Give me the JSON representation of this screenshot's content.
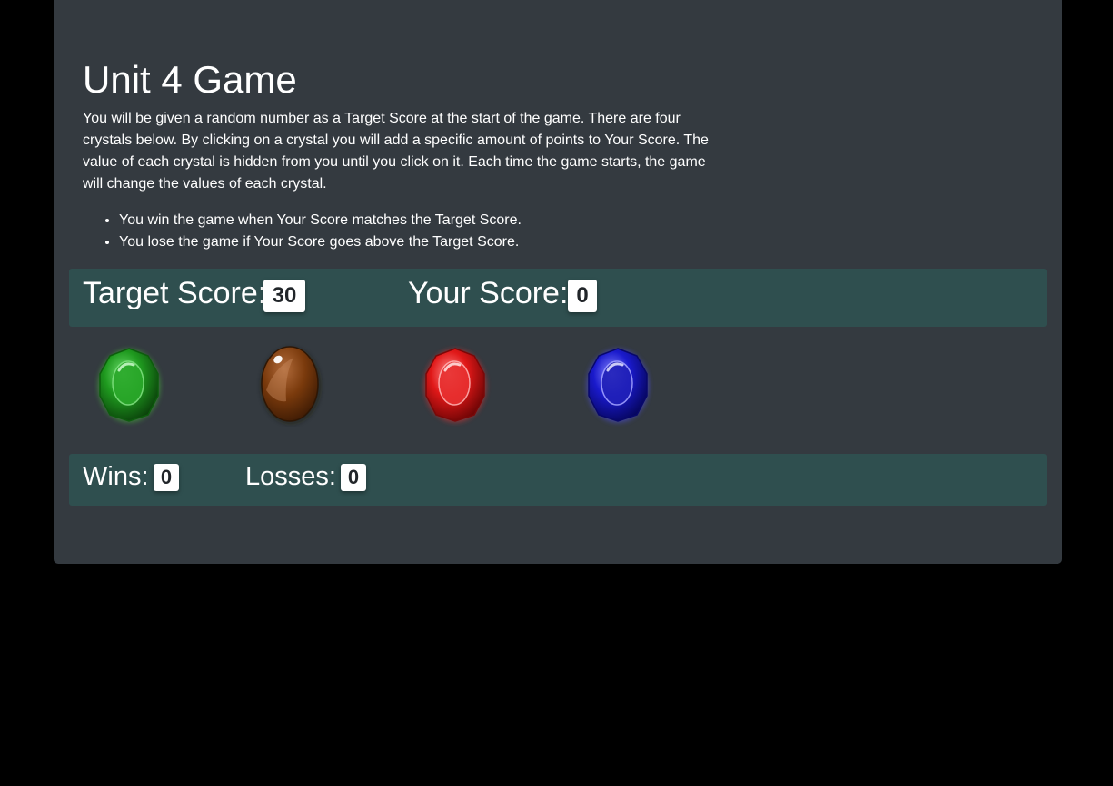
{
  "page": {
    "title": "Unit 4 Game",
    "intro": "You will be given a random number as a Target Score at the start of the game. There are four crystals below. By clicking on a crystal you will add a specific amount of points to Your Score. The value of each crystal is hidden from you until you click on it. Each time the game starts, the game will change the values of each crystal.",
    "rules": [
      "You win the game when Your Score matches the Target Score.",
      "You lose the game if Your Score goes above the Target Score."
    ]
  },
  "scoreboard": {
    "target_label": "Target Score:",
    "target_value": "30",
    "your_label": "Your Score:",
    "your_value": "0"
  },
  "record": {
    "wins_label": "Wins:",
    "wins_value": "0",
    "losses_label": "Losses:",
    "losses_value": "0"
  },
  "crystals": [
    {
      "name": "green-crystal",
      "color": "#1a9e1a"
    },
    {
      "name": "brown-crystal",
      "color": "#7a3a0c"
    },
    {
      "name": "red-crystal",
      "color": "#d81818"
    },
    {
      "name": "blue-crystal",
      "color": "#1818c8"
    }
  ],
  "colors": {
    "background": "#000000",
    "panel": "#343a40",
    "band": "#2f4f4f",
    "text": "#ffffff"
  }
}
